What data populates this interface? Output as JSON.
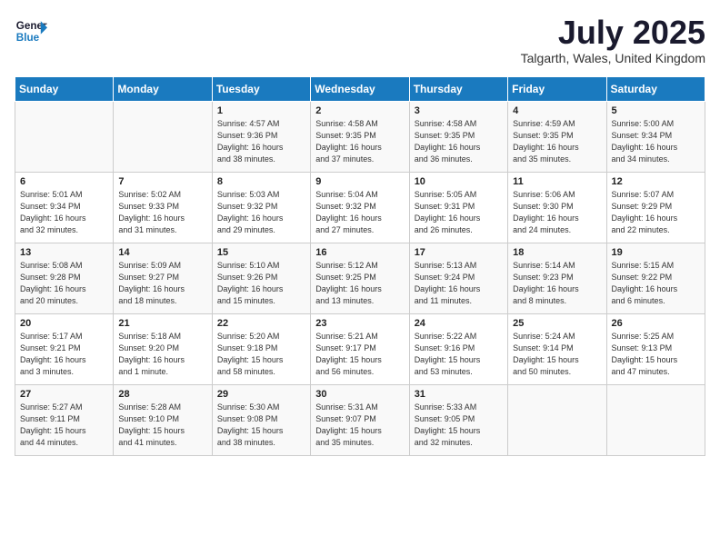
{
  "header": {
    "logo_line1": "General",
    "logo_line2": "Blue",
    "month": "July 2025",
    "location": "Talgarth, Wales, United Kingdom"
  },
  "weekdays": [
    "Sunday",
    "Monday",
    "Tuesday",
    "Wednesday",
    "Thursday",
    "Friday",
    "Saturday"
  ],
  "weeks": [
    [
      {
        "day": "",
        "info": ""
      },
      {
        "day": "",
        "info": ""
      },
      {
        "day": "1",
        "info": "Sunrise: 4:57 AM\nSunset: 9:36 PM\nDaylight: 16 hours\nand 38 minutes."
      },
      {
        "day": "2",
        "info": "Sunrise: 4:58 AM\nSunset: 9:35 PM\nDaylight: 16 hours\nand 37 minutes."
      },
      {
        "day": "3",
        "info": "Sunrise: 4:58 AM\nSunset: 9:35 PM\nDaylight: 16 hours\nand 36 minutes."
      },
      {
        "day": "4",
        "info": "Sunrise: 4:59 AM\nSunset: 9:35 PM\nDaylight: 16 hours\nand 35 minutes."
      },
      {
        "day": "5",
        "info": "Sunrise: 5:00 AM\nSunset: 9:34 PM\nDaylight: 16 hours\nand 34 minutes."
      }
    ],
    [
      {
        "day": "6",
        "info": "Sunrise: 5:01 AM\nSunset: 9:34 PM\nDaylight: 16 hours\nand 32 minutes."
      },
      {
        "day": "7",
        "info": "Sunrise: 5:02 AM\nSunset: 9:33 PM\nDaylight: 16 hours\nand 31 minutes."
      },
      {
        "day": "8",
        "info": "Sunrise: 5:03 AM\nSunset: 9:32 PM\nDaylight: 16 hours\nand 29 minutes."
      },
      {
        "day": "9",
        "info": "Sunrise: 5:04 AM\nSunset: 9:32 PM\nDaylight: 16 hours\nand 27 minutes."
      },
      {
        "day": "10",
        "info": "Sunrise: 5:05 AM\nSunset: 9:31 PM\nDaylight: 16 hours\nand 26 minutes."
      },
      {
        "day": "11",
        "info": "Sunrise: 5:06 AM\nSunset: 9:30 PM\nDaylight: 16 hours\nand 24 minutes."
      },
      {
        "day": "12",
        "info": "Sunrise: 5:07 AM\nSunset: 9:29 PM\nDaylight: 16 hours\nand 22 minutes."
      }
    ],
    [
      {
        "day": "13",
        "info": "Sunrise: 5:08 AM\nSunset: 9:28 PM\nDaylight: 16 hours\nand 20 minutes."
      },
      {
        "day": "14",
        "info": "Sunrise: 5:09 AM\nSunset: 9:27 PM\nDaylight: 16 hours\nand 18 minutes."
      },
      {
        "day": "15",
        "info": "Sunrise: 5:10 AM\nSunset: 9:26 PM\nDaylight: 16 hours\nand 15 minutes."
      },
      {
        "day": "16",
        "info": "Sunrise: 5:12 AM\nSunset: 9:25 PM\nDaylight: 16 hours\nand 13 minutes."
      },
      {
        "day": "17",
        "info": "Sunrise: 5:13 AM\nSunset: 9:24 PM\nDaylight: 16 hours\nand 11 minutes."
      },
      {
        "day": "18",
        "info": "Sunrise: 5:14 AM\nSunset: 9:23 PM\nDaylight: 16 hours\nand 8 minutes."
      },
      {
        "day": "19",
        "info": "Sunrise: 5:15 AM\nSunset: 9:22 PM\nDaylight: 16 hours\nand 6 minutes."
      }
    ],
    [
      {
        "day": "20",
        "info": "Sunrise: 5:17 AM\nSunset: 9:21 PM\nDaylight: 16 hours\nand 3 minutes."
      },
      {
        "day": "21",
        "info": "Sunrise: 5:18 AM\nSunset: 9:20 PM\nDaylight: 16 hours\nand 1 minute."
      },
      {
        "day": "22",
        "info": "Sunrise: 5:20 AM\nSunset: 9:18 PM\nDaylight: 15 hours\nand 58 minutes."
      },
      {
        "day": "23",
        "info": "Sunrise: 5:21 AM\nSunset: 9:17 PM\nDaylight: 15 hours\nand 56 minutes."
      },
      {
        "day": "24",
        "info": "Sunrise: 5:22 AM\nSunset: 9:16 PM\nDaylight: 15 hours\nand 53 minutes."
      },
      {
        "day": "25",
        "info": "Sunrise: 5:24 AM\nSunset: 9:14 PM\nDaylight: 15 hours\nand 50 minutes."
      },
      {
        "day": "26",
        "info": "Sunrise: 5:25 AM\nSunset: 9:13 PM\nDaylight: 15 hours\nand 47 minutes."
      }
    ],
    [
      {
        "day": "27",
        "info": "Sunrise: 5:27 AM\nSunset: 9:11 PM\nDaylight: 15 hours\nand 44 minutes."
      },
      {
        "day": "28",
        "info": "Sunrise: 5:28 AM\nSunset: 9:10 PM\nDaylight: 15 hours\nand 41 minutes."
      },
      {
        "day": "29",
        "info": "Sunrise: 5:30 AM\nSunset: 9:08 PM\nDaylight: 15 hours\nand 38 minutes."
      },
      {
        "day": "30",
        "info": "Sunrise: 5:31 AM\nSunset: 9:07 PM\nDaylight: 15 hours\nand 35 minutes."
      },
      {
        "day": "31",
        "info": "Sunrise: 5:33 AM\nSunset: 9:05 PM\nDaylight: 15 hours\nand 32 minutes."
      },
      {
        "day": "",
        "info": ""
      },
      {
        "day": "",
        "info": ""
      }
    ]
  ]
}
